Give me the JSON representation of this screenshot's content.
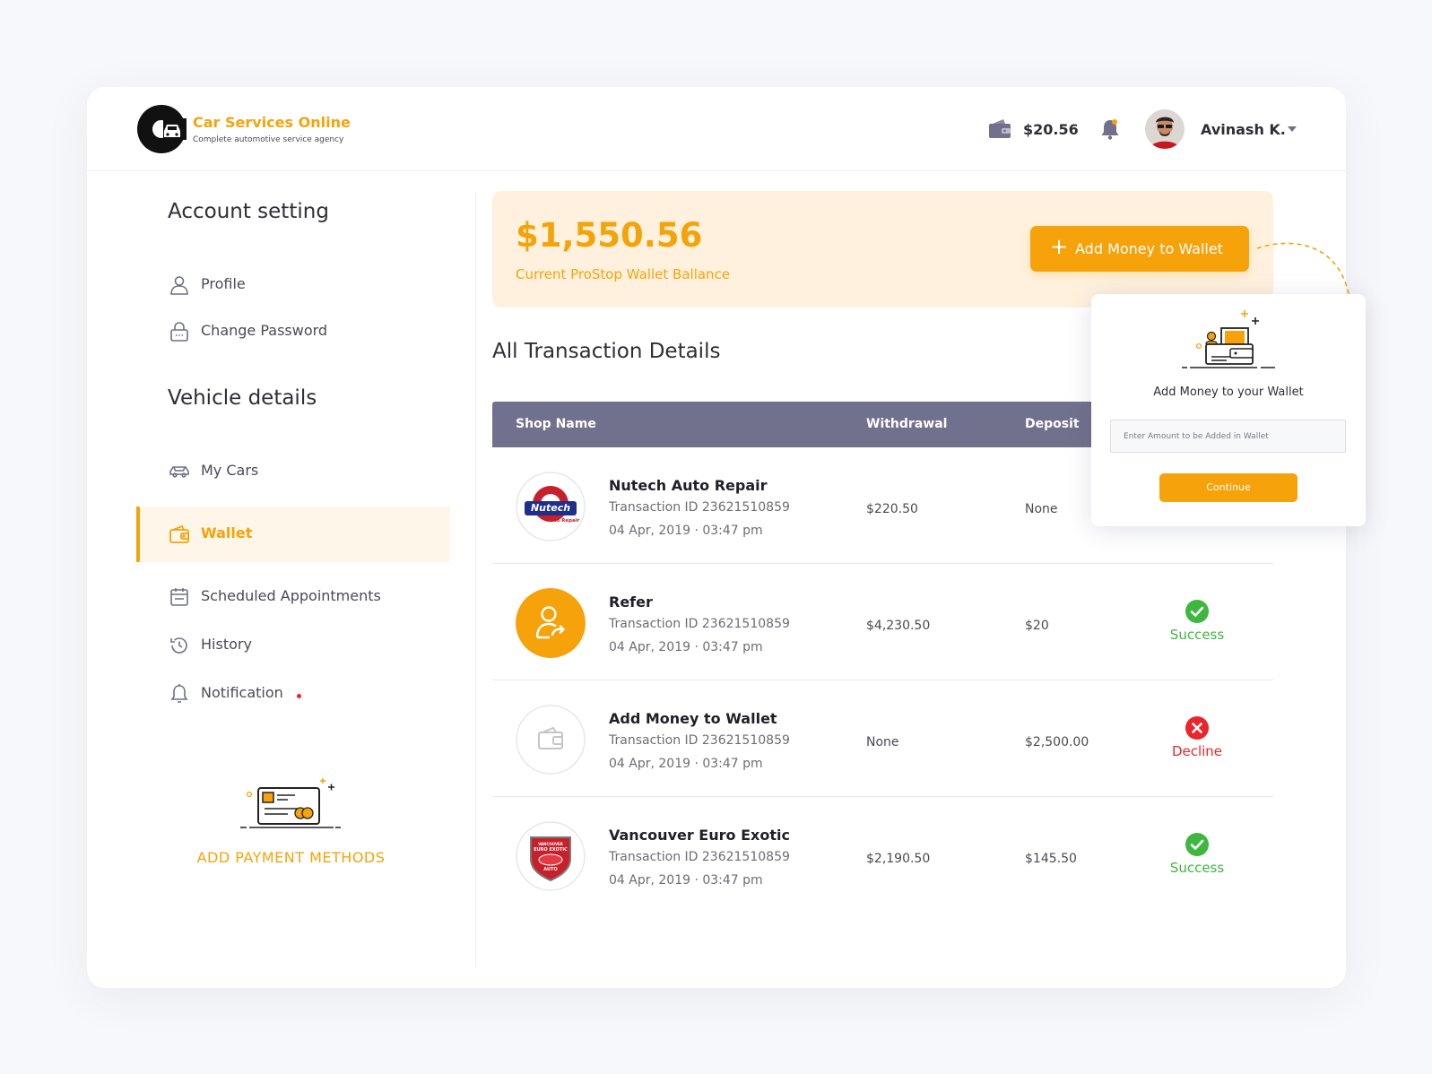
{
  "brand": {
    "name": "Car Services Online",
    "tagline": "Complete automotive service agency"
  },
  "header": {
    "wallet_balance": "$20.56",
    "user_name": "Avinash K."
  },
  "sidebar": {
    "account_title": "Account setting",
    "vehicle_title": "Vehicle details",
    "items": [
      {
        "label": "Profile",
        "icon": "user-icon"
      },
      {
        "label": "Change Password",
        "icon": "lock-icon"
      },
      {
        "label": "My Cars",
        "icon": "car-icon"
      },
      {
        "label": "Wallet",
        "icon": "wallet-icon",
        "active": true
      },
      {
        "label": "Scheduled Appointments",
        "icon": "calendar-icon"
      },
      {
        "label": "History",
        "icon": "history-icon"
      },
      {
        "label": "Notification",
        "icon": "bell-icon",
        "badge": true
      }
    ],
    "add_payment_label": "ADD PAYMENT METHODS"
  },
  "wallet": {
    "balance": "$1,550.56",
    "caption": "Current ProStop Wallet Ballance",
    "add_button": "Add Money to Wallet"
  },
  "transactions": {
    "title": "All Transaction Details",
    "columns": {
      "shop": "Shop Name",
      "withdrawal": "Withdrawal",
      "deposit": "Deposit"
    },
    "rows": [
      {
        "name": "Nutech Auto Repair",
        "txid": "Transaction ID 23621510859",
        "date": "04 Apr, 2019  ·  03:47 pm",
        "withdrawal": "$220.50",
        "deposit": "None",
        "status": ""
      },
      {
        "name": "Refer",
        "txid": "Transaction ID 23621510859",
        "date": "04 Apr, 2019  ·  03:47 pm",
        "withdrawal": "$4,230.50",
        "deposit": "$20",
        "status": "Success"
      },
      {
        "name": "Add Money to Wallet",
        "txid": "Transaction ID 23621510859",
        "date": "04 Apr, 2019  ·  03:47 pm",
        "withdrawal": "None",
        "deposit": "$2,500.00",
        "status": "Decline"
      },
      {
        "name": "Vancouver Euro Exotic",
        "txid": "Transaction ID 23621510859",
        "date": "04 Apr, 2019  ·  03:47 pm",
        "withdrawal": "$2,190.50",
        "deposit": "$145.50",
        "status": "Success"
      }
    ]
  },
  "logos": {
    "nutech_line1": "Nutech",
    "nutech_line2": "Auto Repair",
    "vee_line1": "VANCOUVER",
    "vee_line2": "EURO EXOTIC",
    "vee_line3": "AUTO"
  },
  "popup": {
    "title": "Add Money to your Wallet",
    "input_placeholder": "Enter Amount to be Added in Wallet",
    "input_value": "",
    "button": "Continue"
  },
  "colors": {
    "accent": "#F5A20B",
    "table_header": "#72718D",
    "success": "#3FB73F",
    "decline": "#E8262B"
  }
}
